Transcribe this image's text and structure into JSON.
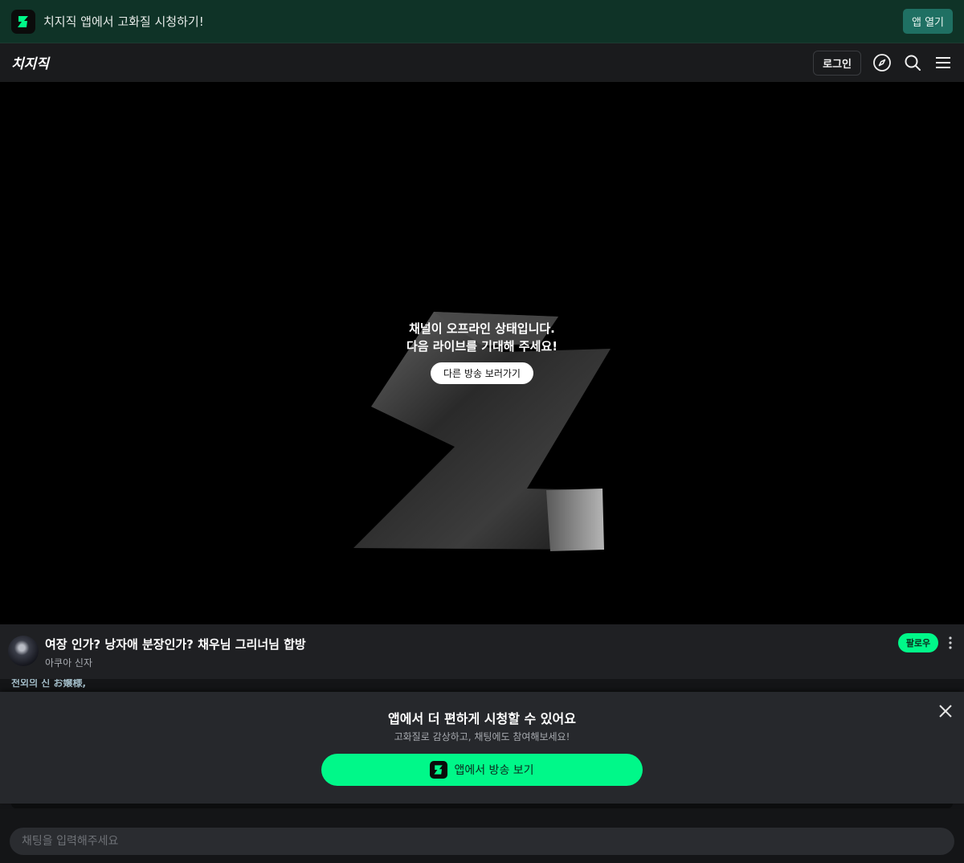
{
  "app_banner": {
    "text": "치지직 앱에서 고화질 시청하기!",
    "open_button": "앱 열기"
  },
  "header": {
    "brand": "치지직",
    "login_label": "로그인",
    "icons": [
      "compass-icon",
      "search-icon",
      "menu-icon"
    ]
  },
  "player": {
    "offline_line1": "채널이 오프라인 상태입니다.",
    "offline_line2": "다음 라이브를 기대해 주세요!",
    "other_streams_button": "다른 방송 보러가기"
  },
  "stream_info": {
    "title": "여장 인가? 낭자애 분장인가? 채우님 그리너님 합방",
    "streamer": "아쿠아 신자",
    "follow_label": "팔로우"
  },
  "chat_peek": {
    "text": "천외의 신 お嬢様,"
  },
  "app_sheet": {
    "title": "앱에서 더 편하게 시청할 수 있어요",
    "subtitle": "고화질로 감상하고, 채팅에도 참여해보세요!",
    "button_label": "앱에서 방송 보기"
  },
  "chat_input": {
    "placeholder": "채팅을 입력해주세요"
  },
  "colors": {
    "accent": "#00f889",
    "banner_bg": "#0f3327",
    "open_button_bg": "#1f7063"
  }
}
